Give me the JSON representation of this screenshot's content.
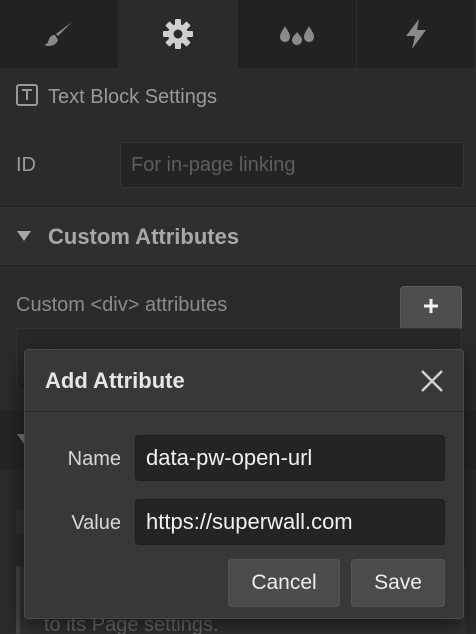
{
  "tabs": [
    {
      "icon": "brush-icon",
      "active": false
    },
    {
      "icon": "gear-icon",
      "active": true
    },
    {
      "icon": "drops-icon",
      "active": false
    },
    {
      "icon": "lightning-icon",
      "active": false
    }
  ],
  "settings": {
    "title": "Text Block Settings",
    "id_label": "ID",
    "id_placeholder": "For in-page linking"
  },
  "custom_attributes": {
    "section_title": "Custom Attributes",
    "div_label": "Custom <div> attributes",
    "add_label": "+"
  },
  "lower": {
    "partial_text": "to its Page settings."
  },
  "modal": {
    "title": "Add Attribute",
    "name_label": "Name",
    "name_value": "data-pw-open-url",
    "value_label": "Value",
    "value_value": "https://superwall.com",
    "cancel_label": "Cancel",
    "save_label": "Save"
  },
  "colors": {
    "panel_bg": "#2b2b2b",
    "modal_bg": "#383838",
    "input_bg": "#242424",
    "button_bg": "#4b4b4b"
  }
}
